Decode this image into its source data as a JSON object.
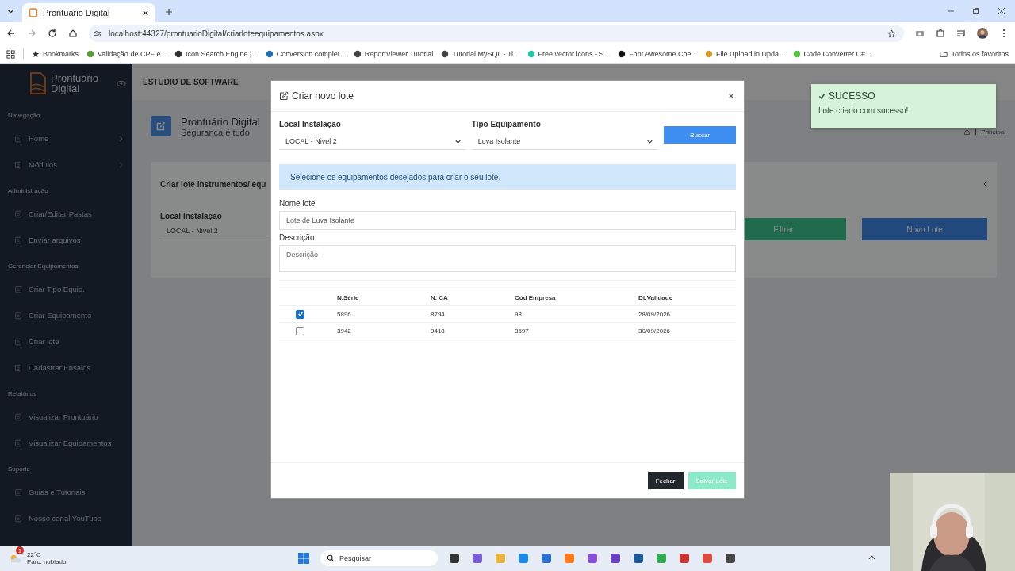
{
  "browser": {
    "tab_title": "Prontuário Digital",
    "url": "localhost:44327/prontuarioDigital/criarloteequipamentos.aspx",
    "bookmarks": [
      {
        "label": "Bookmarks"
      },
      {
        "label": "Validação de CPF e..."
      },
      {
        "label": "Icon Search Engine |..."
      },
      {
        "label": "Conversion complet..."
      },
      {
        "label": "ReportViewer Tutorial"
      },
      {
        "label": "Tutorial MySQL - Ti..."
      },
      {
        "label": "Free vector icons - S..."
      },
      {
        "label": "Font Awesome Che..."
      },
      {
        "label": "File Upload in Upda..."
      },
      {
        "label": "Code Converter C#..."
      }
    ],
    "all_bookmarks": "Todos os favoritos"
  },
  "sidebar": {
    "logo": [
      "Prontuário",
      "Digital"
    ],
    "sections": [
      {
        "title": "Navegação",
        "items": [
          {
            "label": "Home",
            "expandable": true
          },
          {
            "label": "Módulos",
            "expandable": true
          }
        ]
      },
      {
        "title": "Administração",
        "items": [
          {
            "label": "Criar/Editar Pastas",
            "expandable": false
          },
          {
            "label": "Enviar arquivos",
            "expandable": false
          }
        ]
      },
      {
        "title": "Gerenciar Equipamentos",
        "items": [
          {
            "label": "Criar Tipo Equip.",
            "expandable": false
          },
          {
            "label": "Criar Equipamento",
            "expandable": false
          },
          {
            "label": "Criar lote",
            "expandable": false
          },
          {
            "label": "Cadastrar Ensaios",
            "expandable": false
          }
        ]
      },
      {
        "title": "Relatórios",
        "items": [
          {
            "label": "Visualizar Prontuário",
            "expandable": false
          },
          {
            "label": "Visualizar Equipamentos",
            "expandable": false
          }
        ]
      },
      {
        "title": "Suporte",
        "items": [
          {
            "label": "Guias e Tutoriais",
            "expandable": false
          },
          {
            "label": "Nosso canal YouTube",
            "expandable": false
          }
        ]
      }
    ]
  },
  "header": {
    "brand": "ESTUDIO DE SOFTWARE"
  },
  "page": {
    "title": "Prontuário Digital",
    "subtitle": "Segurança é tudo",
    "breadcrumb": "Principal"
  },
  "card": {
    "title": "Criar lote instrumentos/ equ",
    "field_label": "Local Instalação",
    "field_value": "LOCAL - Nivel 2",
    "buttons": [
      {
        "label": "Filtrar",
        "kind": "success"
      },
      {
        "label": "Novo Lote",
        "kind": "primary"
      }
    ]
  },
  "modal": {
    "title": "Criar novo lote",
    "local_label": "Local Instalação",
    "local_value": "LOCAL - Nivel 2",
    "tipo_label": "Tipo Equipamento",
    "tipo_value": "Luva Isolante",
    "search_button": "Buscar",
    "alert": "Selecione os equipamentos desejados para criar o seu lote.",
    "name_label": "Nome lote",
    "name_value": "Lote de Luva Isolante",
    "desc_label": "Descrição",
    "desc_placeholder": "Descrição",
    "table": {
      "columns": [
        "N.Série",
        "N. CA",
        "Cód Empresa",
        "Dt.Validade"
      ],
      "rows": [
        {
          "checked": true,
          "cells": [
            "5896",
            "8794",
            "98",
            "28/09/2026"
          ]
        },
        {
          "checked": false,
          "cells": [
            "3942",
            "9418",
            "8597",
            "30/09/2026"
          ]
        }
      ]
    },
    "buttons": [
      {
        "label": "Fechar",
        "kind": "dark",
        "disabled": false
      },
      {
        "label": "Salvar Lote",
        "kind": "success",
        "disabled": true
      }
    ]
  },
  "toast": {
    "title": "SUCESSO",
    "message": "Lote criado com sucesso!"
  },
  "taskbar": {
    "temperature": "22°C",
    "weather": "Parc. nublado",
    "weather_badge": "1",
    "search_placeholder": "Pesquisar"
  }
}
